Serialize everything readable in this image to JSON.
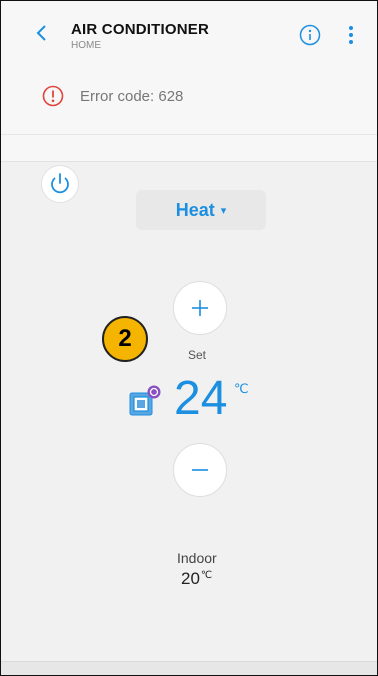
{
  "header": {
    "back_glyph": "<",
    "title": "AIR CONDITIONER",
    "subtitle": "HOME",
    "info_icon": "info-circle-icon",
    "more_icon": "vertical-dots-icon"
  },
  "status": {
    "error_icon": "alert-circle-icon",
    "error_text": "Error code: 628"
  },
  "controls": {
    "power_icon": "power-icon",
    "mode_label": "Heat",
    "mode_caret": "▾",
    "increase_icon": "plus-icon",
    "decrease_icon": "minus-icon",
    "set_label": "Set",
    "set_temperature": "24",
    "set_unit": "℃",
    "unit_icon": "indoor-unit-icon"
  },
  "indoor": {
    "label": "Indoor",
    "temperature": "20",
    "unit": "℃"
  },
  "annotation": {
    "badge_number": "2"
  },
  "colors": {
    "accent": "#1c8fe0",
    "error": "#e0453a",
    "badge": "#f4b400"
  }
}
